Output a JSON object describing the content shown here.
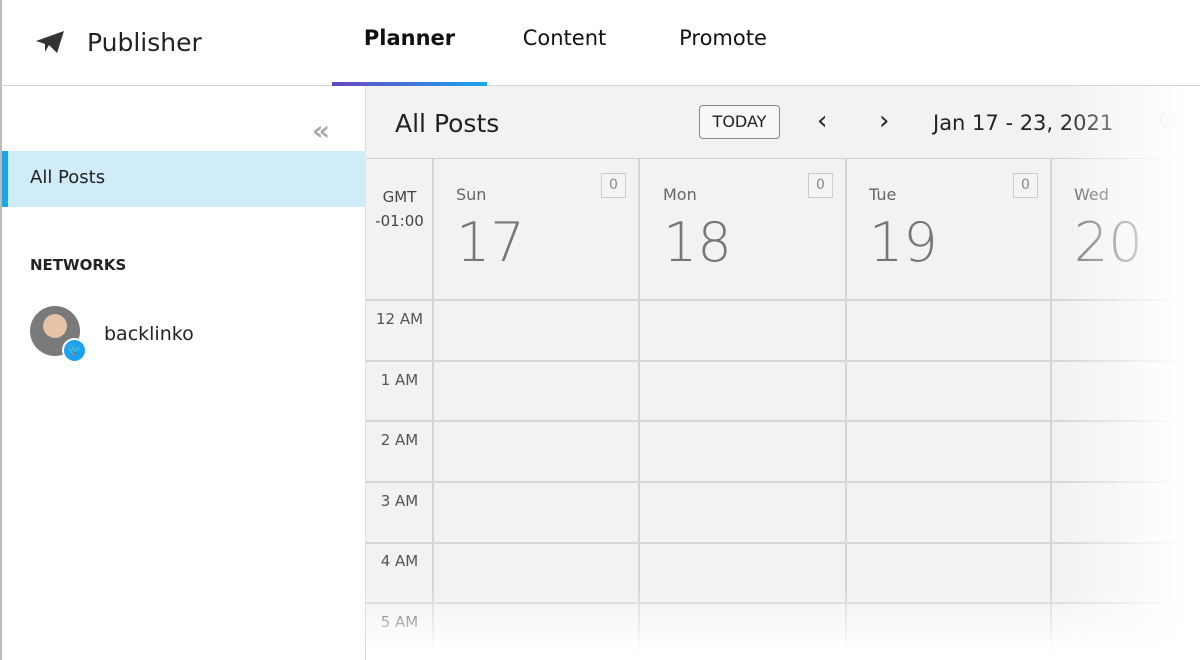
{
  "header": {
    "brand": "Publisher",
    "tabs": [
      {
        "label": "Planner",
        "active": true
      },
      {
        "label": "Content"
      },
      {
        "label": "Promote"
      }
    ],
    "accent_gradient": [
      "#6b46c1",
      "#1aa7ec"
    ]
  },
  "sidebar": {
    "collapse_icon": "double-chevron-left-icon",
    "selected_item": "All Posts",
    "networks_title": "NETWORKS",
    "networks": [
      {
        "name": "backlinko",
        "network": "twitter"
      }
    ]
  },
  "main": {
    "title": "All Posts",
    "today_label": "TODAY",
    "date_range": "Jan 17 - 23, 2021",
    "timezone": [
      "GMT",
      "-01:00"
    ],
    "days": [
      {
        "name": "Sun",
        "date": "17",
        "count": "0"
      },
      {
        "name": "Mon",
        "date": "18",
        "count": "0"
      },
      {
        "name": "Tue",
        "date": "19",
        "count": "0"
      },
      {
        "name": "Wed",
        "date": "20"
      }
    ],
    "hours": [
      "12 AM",
      "1 AM",
      "2 AM",
      "3 AM",
      "4 AM",
      "5 AM"
    ]
  }
}
